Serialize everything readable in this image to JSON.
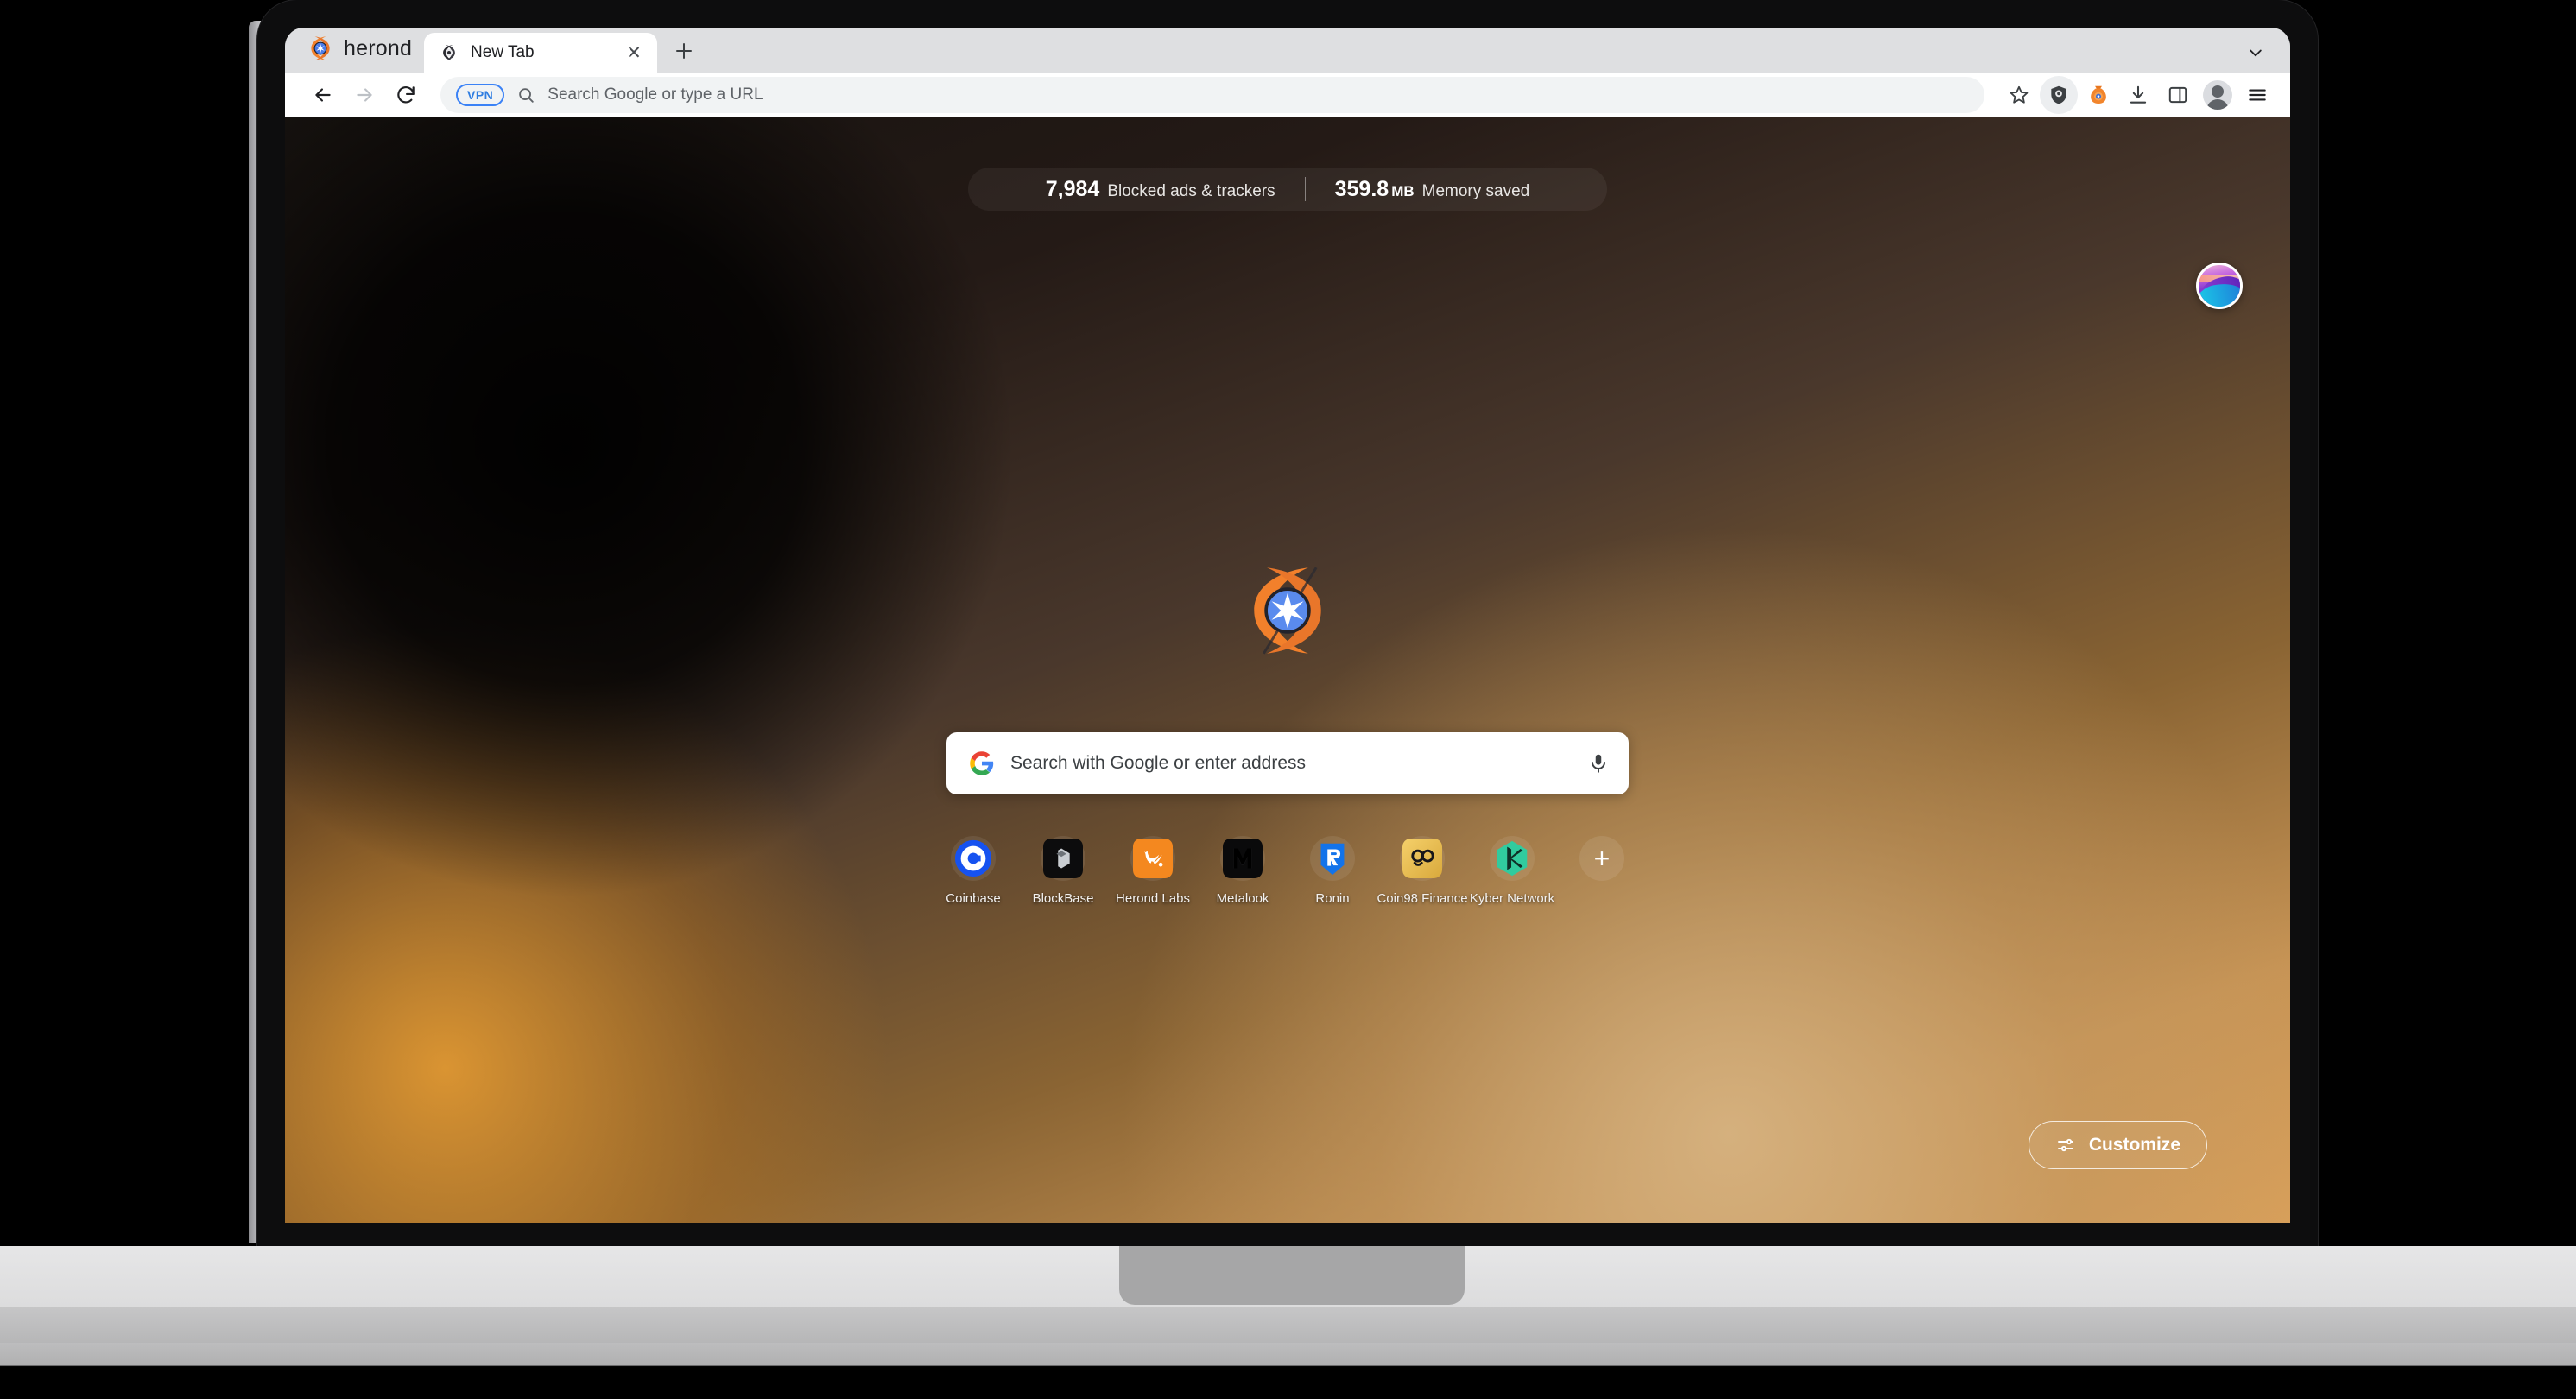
{
  "browser": {
    "brand_name": "herond",
    "brand_logo_icon": "herond-logo-icon",
    "tabs": [
      {
        "title": "New Tab",
        "favicon_icon": "herond-favicon-icon",
        "close_icon": "close-icon"
      }
    ],
    "new_tab_button_label": "+",
    "tab_search_icon": "chevron-down-icon",
    "toolbar": {
      "back_icon": "back-arrow-icon",
      "forward_icon": "forward-arrow-icon",
      "reload_icon": "reload-icon",
      "omnibox": {
        "vpn_badge": "VPN",
        "search_icon": "search-icon",
        "placeholder": "Search Google or type a URL",
        "value": ""
      },
      "bookmark_icon": "star-icon",
      "shield_icon": "shield-icon",
      "rewards_icon": "coin-bag-icon",
      "downloads_icon": "download-icon",
      "split_view_icon": "split-view-icon",
      "profile_icon": "avatar-icon",
      "menu_icon": "hamburger-menu-icon"
    }
  },
  "newtab": {
    "stats": [
      {
        "number": "7,984",
        "unit": "",
        "label": "Blocked ads & trackers"
      },
      {
        "number": "359.8",
        "unit": "MB",
        "label": "Memory saved"
      }
    ],
    "theme_button_icon": "wallpaper-theme-icon",
    "hero_logo_icon": "herond-hero-logo-icon",
    "search": {
      "engine_icon": "google-g-icon",
      "placeholder": "Search with Google or enter address",
      "value": "",
      "voice_icon": "microphone-icon"
    },
    "shortcuts": [
      {
        "label": "Coinbase",
        "icon": "coinbase-icon"
      },
      {
        "label": "BlockBase",
        "icon": "blockbase-icon"
      },
      {
        "label": "Herond Labs",
        "icon": "herond-labs-icon"
      },
      {
        "label": "Metalook",
        "icon": "metalook-icon"
      },
      {
        "label": "Ronin",
        "icon": "ronin-icon"
      },
      {
        "label": "Coin98 Finance",
        "icon": "coin98-icon"
      },
      {
        "label": "Kyber Network",
        "icon": "kyber-network-icon"
      }
    ],
    "add_shortcut_label": "+",
    "customize": {
      "label": "Customize",
      "icon": "tune-sliders-icon"
    }
  },
  "colors": {
    "brand_orange": "#F0822A",
    "brand_blue": "#4A7BE8",
    "vpn_blue": "#2F7DE1",
    "accent_amber": "#D9A05A"
  }
}
